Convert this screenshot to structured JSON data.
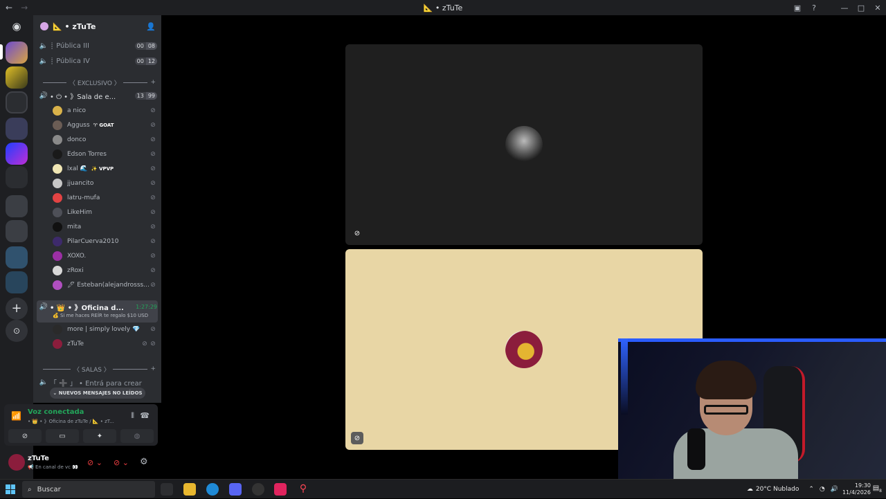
{
  "window": {
    "title": "📐 • zTuTe"
  },
  "guild": {
    "name": "📐 • zTuTe"
  },
  "channels": [
    {
      "name": "┊ Pública III",
      "users": "00",
      "limit": "08"
    },
    {
      "name": "┊ Pública IV",
      "users": "00",
      "limit": "12"
    }
  ],
  "categories": {
    "exclusivo": "〈 EXCLUSIVO 〉",
    "salas": "〈 SALAS 〉"
  },
  "sala": {
    "name": "• ⏻ • 》Sala de e...",
    "users": "13",
    "limit": "99"
  },
  "sala_users": [
    {
      "name": "a nico",
      "tag": ""
    },
    {
      "name": "Agguss",
      "tag": "♈ GOAT"
    },
    {
      "name": "donco",
      "tag": ""
    },
    {
      "name": "Edson Torres",
      "tag": ""
    },
    {
      "name": "lxal 🌊",
      "tag": "✨ VPVP"
    },
    {
      "name": "jjuancito",
      "tag": ""
    },
    {
      "name": "latru-mufa",
      "tag": ""
    },
    {
      "name": "LikeHim",
      "tag": ""
    },
    {
      "name": "mita",
      "tag": ""
    },
    {
      "name": "PilarCuerva2010",
      "tag": ""
    },
    {
      "name": "XOXO.",
      "tag": ""
    },
    {
      "name": "zRoxi",
      "tag": ""
    },
    {
      "name": "🖊 Esteban(alejandrosss...",
      "tag": ""
    }
  ],
  "oficina": {
    "name": "• 👑 • 》Oficina d...",
    "timer": "1:27:29",
    "status": "💰 Si me haces REÍR te regalo $10 USD"
  },
  "oficina_users": [
    {
      "name": "more | simply lovely 💎"
    },
    {
      "name": "zTuTe"
    }
  ],
  "create_channel": "「 ➕ 」 • Entrá para crear",
  "new_messages": "⌄ NUEVOS MENSAJES NO LEÍDOS",
  "voice": {
    "status": "Voz conectada",
    "location": "• 👑 • 》Oficina de zTuTe / 📐 • zT..."
  },
  "me": {
    "name": "zTuTe",
    "sub": "📢 En canal de vc 👀"
  },
  "taskbar": {
    "search": "Buscar",
    "weather": "20°C  Nublado",
    "time": "19:30",
    "date": "11/4/2026",
    "notif": "8"
  }
}
